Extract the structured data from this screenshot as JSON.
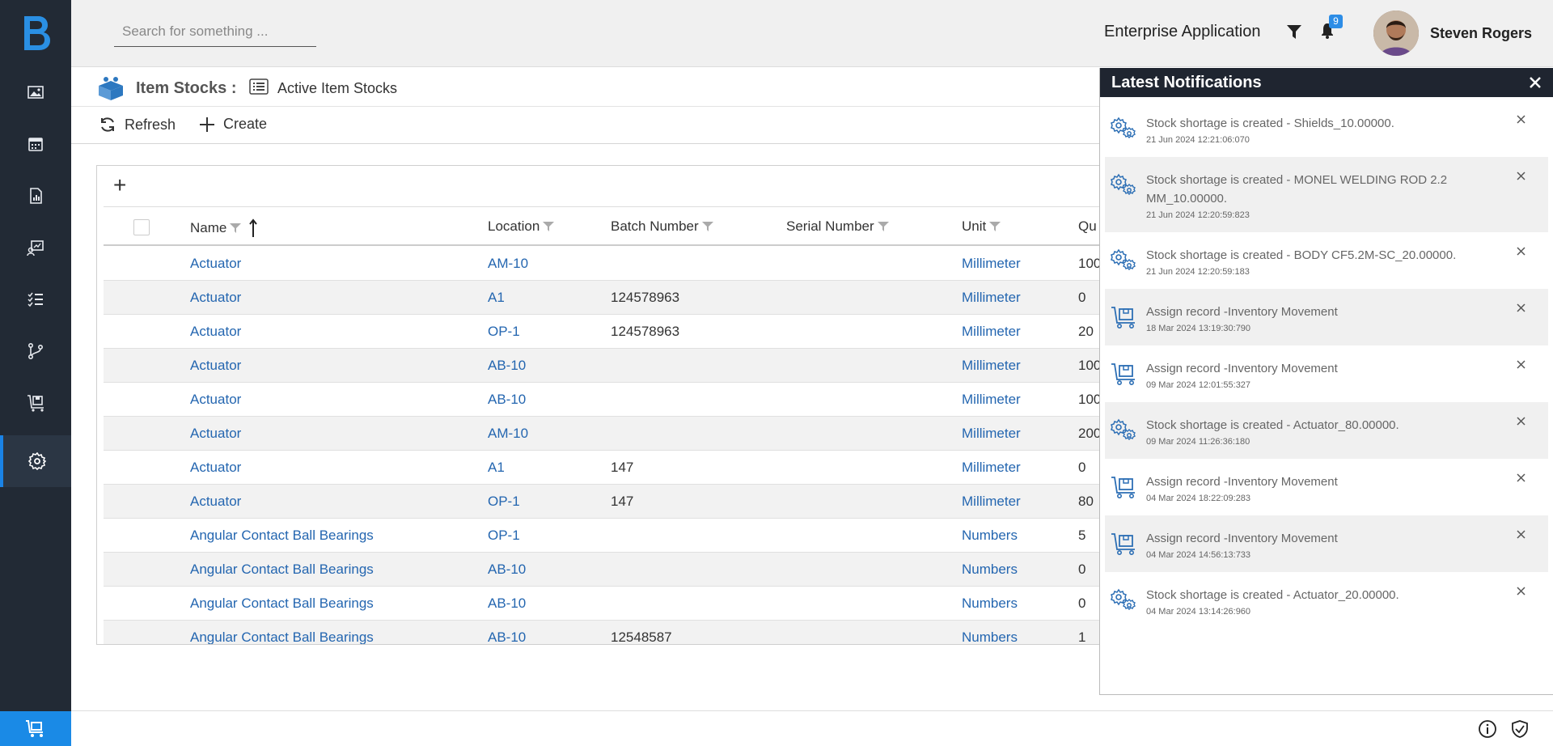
{
  "header": {
    "search_placeholder": "Search for something ...",
    "app_title": "Enterprise Application",
    "notification_count": "9",
    "user_name": "Steven Rogers"
  },
  "sidebar": {
    "items": [
      {
        "icon": "gallery-icon"
      },
      {
        "icon": "calendar-icon"
      },
      {
        "icon": "report-icon"
      },
      {
        "icon": "dashboard-icon"
      },
      {
        "icon": "checklist-icon"
      },
      {
        "icon": "workflow-icon"
      },
      {
        "icon": "inventory-icon"
      },
      {
        "icon": "settings-icon",
        "active": true
      }
    ],
    "footer_icon": "cart-icon"
  },
  "page": {
    "title": "Item Stocks :",
    "view_label": "Active Item Stocks"
  },
  "toolbar": {
    "refresh_label": "Refresh",
    "create_label": "Create"
  },
  "grid": {
    "add_label": "+",
    "columns": {
      "name": "Name",
      "location": "Location",
      "batch": "Batch Number",
      "serial": "Serial Number",
      "unit": "Unit",
      "qty": "Qu"
    },
    "rows": [
      {
        "name": "Actuator",
        "location": "AM-10",
        "batch": "",
        "serial": "",
        "unit": "Millimeter",
        "qty": "100"
      },
      {
        "name": "Actuator",
        "location": "A1",
        "batch": "124578963",
        "serial": "",
        "unit": "Millimeter",
        "qty": "0"
      },
      {
        "name": "Actuator",
        "location": "OP-1",
        "batch": "124578963",
        "serial": "",
        "unit": "Millimeter",
        "qty": "20"
      },
      {
        "name": "Actuator",
        "location": "AB-10",
        "batch": "",
        "serial": "",
        "unit": "Millimeter",
        "qty": "100"
      },
      {
        "name": "Actuator",
        "location": "AB-10",
        "batch": "",
        "serial": "",
        "unit": "Millimeter",
        "qty": "100"
      },
      {
        "name": "Actuator",
        "location": "AM-10",
        "batch": "",
        "serial": "",
        "unit": "Millimeter",
        "qty": "200"
      },
      {
        "name": "Actuator",
        "location": "A1",
        "batch": "147",
        "serial": "",
        "unit": "Millimeter",
        "qty": "0"
      },
      {
        "name": "Actuator",
        "location": "OP-1",
        "batch": "147",
        "serial": "",
        "unit": "Millimeter",
        "qty": "80"
      },
      {
        "name": "Angular Contact Ball Bearings",
        "location": "OP-1",
        "batch": "",
        "serial": "",
        "unit": "Numbers",
        "qty": "5"
      },
      {
        "name": "Angular Contact Ball Bearings",
        "location": "AB-10",
        "batch": "",
        "serial": "",
        "unit": "Numbers",
        "qty": "0"
      },
      {
        "name": "Angular Contact Ball Bearings",
        "location": "AB-10",
        "batch": "",
        "serial": "",
        "unit": "Numbers",
        "qty": "0"
      },
      {
        "name": "Angular Contact Ball Bearings",
        "location": "AB-10",
        "batch": "12548587",
        "serial": "",
        "unit": "Numbers",
        "qty": "1"
      }
    ]
  },
  "notifications": {
    "title": "Latest Notifications",
    "items": [
      {
        "type": "gears",
        "message": "Stock shortage is created - Shields_10.00000.",
        "time": "21 Jun 2024 12:21:06:070"
      },
      {
        "type": "gears",
        "message": "Stock shortage is created - MONEL WELDING ROD 2.2 MM_10.00000.",
        "time": "21 Jun 2024 12:20:59:823"
      },
      {
        "type": "gears",
        "message": "Stock shortage is created - BODY CF5.2M-SC_20.00000.",
        "time": "21 Jun 2024 12:20:59:183"
      },
      {
        "type": "cart",
        "message": "Assign record -Inventory Movement",
        "time": "18 Mar 2024 13:19:30:790"
      },
      {
        "type": "cart",
        "message": "Assign record -Inventory Movement",
        "time": "09 Mar 2024 12:01:55:327"
      },
      {
        "type": "gears",
        "message": "Stock shortage is created - Actuator_80.00000.",
        "time": "09 Mar 2024 11:26:36:180"
      },
      {
        "type": "cart",
        "message": "Assign record -Inventory Movement",
        "time": "04 Mar 2024 18:22:09:283"
      },
      {
        "type": "cart",
        "message": "Assign record -Inventory Movement",
        "time": "04 Mar 2024 14:56:13:733"
      },
      {
        "type": "gears",
        "message": "Stock shortage is created - Actuator_20.00000.",
        "time": "04 Mar 2024 13:14:26:960"
      }
    ]
  },
  "colors": {
    "sidebar_bg": "#222a35",
    "accent": "#1a8ae6",
    "link": "#2466b0"
  }
}
